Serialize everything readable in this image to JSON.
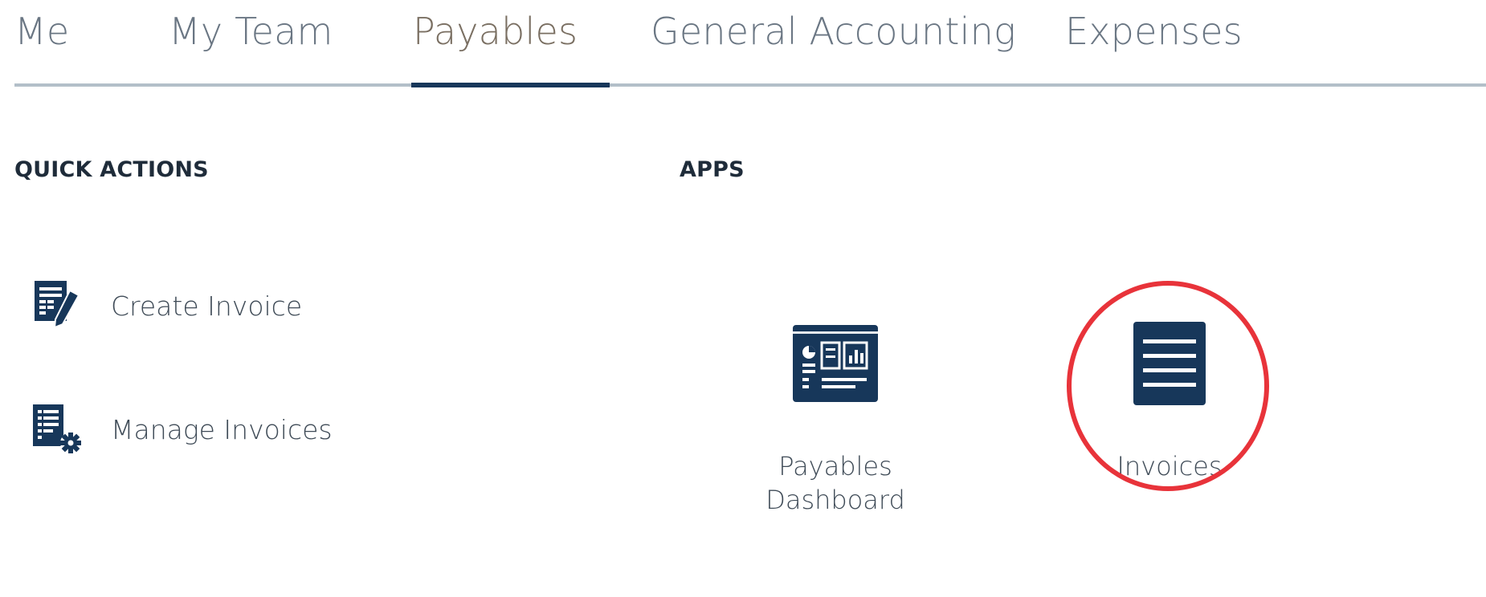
{
  "tabs": [
    {
      "label": "Me",
      "active": false
    },
    {
      "label": "My Team",
      "active": false
    },
    {
      "label": "Payables",
      "active": true
    },
    {
      "label": "General Accounting",
      "active": false
    },
    {
      "label": "Expenses",
      "active": false
    }
  ],
  "quick_actions": {
    "heading": "QUICK ACTIONS",
    "items": [
      {
        "label": "Create Invoice",
        "icon": "create-invoice-icon"
      },
      {
        "label": "Manage Invoices",
        "icon": "manage-invoices-icon"
      }
    ]
  },
  "apps": {
    "heading": "APPS",
    "items": [
      {
        "label_line1": "Payables",
        "label_line2": "Dashboard",
        "icon": "dashboard-icon"
      },
      {
        "label_line1": "Invoices",
        "label_line2": "",
        "icon": "invoices-list-icon",
        "highlighted": true
      }
    ]
  },
  "colors": {
    "accent": "#17375a",
    "icon": "#17375a",
    "highlight": "#e8333a",
    "divider": "#b3bfc9"
  }
}
